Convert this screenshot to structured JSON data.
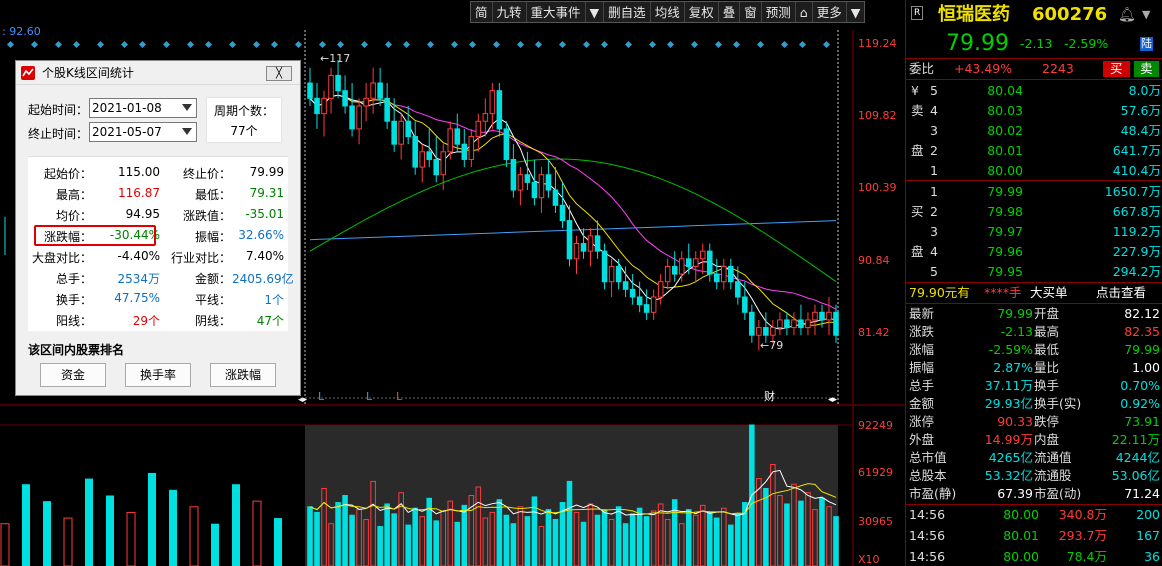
{
  "toolbar": {
    "items": [
      "简",
      "九转",
      "重大事件",
      "▼",
      "删自选",
      "均线",
      "复权",
      "叠",
      "窗",
      "预测",
      "⌂",
      "更多",
      "▼"
    ]
  },
  "chart": {
    "top_left_price": ": 92.60",
    "price_axis": [
      "119.24",
      "109.82",
      "100.39",
      "90.84",
      "81.42"
    ],
    "vol_axis": [
      "92249",
      "61929",
      "30965"
    ],
    "vol_unit": "X10",
    "high_marker": "117",
    "low_marker": "79",
    "bottom_markers": [
      "L",
      "L",
      "L",
      "财"
    ],
    "candles": [
      [
        114,
        116,
        111,
        112
      ],
      [
        112,
        114,
        108,
        110
      ],
      [
        110,
        113,
        107,
        112
      ],
      [
        112,
        116,
        110,
        115
      ],
      [
        115,
        117,
        112,
        113
      ],
      [
        113,
        115,
        110,
        111
      ],
      [
        111,
        114,
        107,
        108
      ],
      [
        108,
        112,
        106,
        111
      ],
      [
        111,
        114,
        109,
        112
      ],
      [
        112,
        116,
        110,
        114
      ],
      [
        114,
        116,
        111,
        112
      ],
      [
        112,
        114,
        108,
        109
      ],
      [
        109,
        112,
        105,
        106
      ],
      [
        106,
        110,
        104,
        109
      ],
      [
        109,
        111,
        106,
        107
      ],
      [
        107,
        109,
        102,
        103
      ],
      [
        103,
        106,
        101,
        105
      ],
      [
        105,
        108,
        103,
        104
      ],
      [
        104,
        107,
        101,
        102
      ],
      [
        102,
        106,
        100,
        105
      ],
      [
        105,
        109,
        104,
        108
      ],
      [
        108,
        110,
        105,
        106
      ],
      [
        106,
        108,
        103,
        104
      ],
      [
        104,
        108,
        103,
        107
      ],
      [
        107,
        110,
        105,
        109
      ],
      [
        109,
        112,
        107,
        110
      ],
      [
        110,
        114,
        108,
        113
      ],
      [
        113,
        114,
        107,
        108
      ],
      [
        108,
        109,
        103,
        104
      ],
      [
        104,
        106,
        99,
        100
      ],
      [
        100,
        103,
        98,
        102
      ],
      [
        102,
        105,
        100,
        101
      ],
      [
        101,
        104,
        98,
        99
      ],
      [
        99,
        103,
        97,
        102
      ],
      [
        102,
        104,
        99,
        100
      ],
      [
        100,
        103,
        97,
        98
      ],
      [
        98,
        101,
        95,
        96
      ],
      [
        96,
        98,
        90,
        91
      ],
      [
        91,
        94,
        89,
        93
      ],
      [
        93,
        95,
        91,
        92
      ],
      [
        92,
        95,
        90,
        94
      ],
      [
        94,
        96,
        91,
        92
      ],
      [
        92,
        93,
        87,
        88
      ],
      [
        88,
        91,
        86,
        90
      ],
      [
        90,
        91,
        87,
        88
      ],
      [
        88,
        90,
        86,
        87
      ],
      [
        87,
        89,
        85,
        86
      ],
      [
        86,
        88,
        84,
        85
      ],
      [
        85,
        87,
        83,
        84
      ],
      [
        84,
        87,
        83,
        86
      ],
      [
        86,
        89,
        85,
        88
      ],
      [
        88,
        91,
        87,
        90
      ],
      [
        90,
        92,
        88,
        89
      ],
      [
        89,
        92,
        88,
        91
      ],
      [
        91,
        93,
        89,
        90
      ],
      [
        90,
        92,
        88,
        91
      ],
      [
        91,
        93,
        89,
        92
      ],
      [
        92,
        93,
        88,
        89
      ],
      [
        89,
        91,
        87,
        88
      ],
      [
        88,
        91,
        87,
        90
      ],
      [
        90,
        91,
        87,
        88
      ],
      [
        88,
        90,
        85,
        86
      ],
      [
        86,
        88,
        83,
        84
      ],
      [
        84,
        85,
        80,
        81
      ],
      [
        81,
        83,
        79,
        82
      ],
      [
        82,
        84,
        80,
        81
      ],
      [
        81,
        83,
        80,
        82
      ],
      [
        82,
        84,
        81,
        83
      ],
      [
        83,
        84,
        81,
        82
      ],
      [
        82,
        84,
        81,
        83
      ],
      [
        83,
        85,
        81,
        82
      ],
      [
        82,
        84,
        81,
        83
      ],
      [
        83,
        85,
        81,
        84
      ],
      [
        84,
        85,
        82,
        83
      ],
      [
        83,
        86,
        81,
        84
      ],
      [
        84,
        85,
        80,
        81
      ]
    ],
    "volumes": [
      0.42,
      0.38,
      0.55,
      0.3,
      0.45,
      0.5,
      0.36,
      0.4,
      0.33,
      0.6,
      0.28,
      0.44,
      0.37,
      0.52,
      0.29,
      0.41,
      0.35,
      0.48,
      0.32,
      0.39,
      0.46,
      0.31,
      0.43,
      0.5,
      0.56,
      0.34,
      0.38,
      0.47,
      0.36,
      0.3,
      0.42,
      0.35,
      0.49,
      0.28,
      0.4,
      0.33,
      0.45,
      0.6,
      0.38,
      0.31,
      0.44,
      0.36,
      0.4,
      0.33,
      0.42,
      0.3,
      0.37,
      0.41,
      0.35,
      0.39,
      0.44,
      0.33,
      0.47,
      0.3,
      0.4,
      0.36,
      0.43,
      0.38,
      0.34,
      0.41,
      0.29,
      0.37,
      0.45,
      1.0,
      0.62,
      0.55,
      0.72,
      0.5,
      0.44,
      0.58,
      0.46,
      0.52,
      0.4,
      0.48,
      0.42,
      0.35
    ]
  },
  "dialog": {
    "title": "个股K线区间统计",
    "close_label": "╳",
    "start_label": "起始时间：",
    "start_value": "2021-01-08",
    "end_label": "终止时间：",
    "end_value": "2021-05-07",
    "period_label": "周期个数：",
    "period_value": "77个",
    "rows": [
      {
        "l1": "起始价：",
        "v1": "115.00",
        "c1": "#000",
        "l2": "终止价：",
        "v2": "79.99",
        "c2": "#000"
      },
      {
        "l1": "最高：",
        "v1": "116.87",
        "c1": "#e00000",
        "l2": "最低：",
        "v2": "79.31",
        "c2": "#008000"
      },
      {
        "l1": "均价：",
        "v1": "94.95",
        "c1": "#000",
        "l2": "涨跌值：",
        "v2": "-35.01",
        "c2": "#008000"
      },
      {
        "l1": "涨跌幅：",
        "v1": "-30.44%",
        "c1": "#008000",
        "l2": "振幅：",
        "v2": "32.66%",
        "c2": "#1070c0"
      },
      {
        "l1": "大盘对比：",
        "v1": "-4.40%",
        "c1": "#000",
        "l2": "行业对比：",
        "v2": "7.40%",
        "c2": "#000"
      },
      {
        "l1": "总手：",
        "v1": "2534万",
        "c1": "#1070c0",
        "l2": "金额：",
        "v2": "2405.69亿",
        "c2": "#1070c0"
      },
      {
        "l1": "换手：",
        "v1": "47.75%",
        "c1": "#1070c0",
        "l2": "平线：",
        "v2": "1个",
        "c2": "#1070c0"
      },
      {
        "l1": "阳线：",
        "v1": "29个",
        "c1": "#e00000",
        "l2": "阴线：",
        "v2": "47个",
        "c2": "#008000"
      }
    ],
    "rank_label": "该区间内股票排名",
    "buttons": [
      "资金",
      "换手率",
      "涨跌幅"
    ]
  },
  "quote": {
    "name": "恒瑞医药",
    "code": "600276",
    "price": "79.99",
    "change": "-2.13",
    "pct": "-2.59%",
    "tag": "陆",
    "weibi_label": "委比",
    "weibi_pct": "+43.49%",
    "weibi_num": "2243",
    "buy_btn": "买",
    "sell_btn": "卖",
    "sell_levels": [
      [
        "¥",
        "5",
        "80.04",
        "8.0万"
      ],
      [
        "卖",
        "4",
        "80.03",
        "57.6万"
      ],
      [
        "",
        "3",
        "80.02",
        "48.4万"
      ],
      [
        "盘",
        "2",
        "80.01",
        "641.7万"
      ],
      [
        "",
        "1",
        "80.00",
        "410.4万"
      ]
    ],
    "buy_levels": [
      [
        "",
        "1",
        "79.99",
        "1650.7万"
      ],
      [
        "买",
        "2",
        "79.98",
        "667.8万"
      ],
      [
        "",
        "3",
        "79.97",
        "119.2万"
      ],
      [
        "盘",
        "4",
        "79.96",
        "227.9万"
      ],
      [
        "",
        "5",
        "79.95",
        "294.2万"
      ]
    ],
    "big_order": {
      "left": "79.90元有",
      "mid": "****手",
      "mid2": "大买单",
      "right": "点击查看"
    },
    "stats": [
      [
        "最新",
        "79.99",
        "grn",
        "开盘",
        "82.12",
        "wht"
      ],
      [
        "涨跌",
        "-2.13",
        "grn",
        "最高",
        "82.35",
        "red"
      ],
      [
        "涨幅",
        "-2.59%",
        "grn",
        "最低",
        "79.99",
        "grn"
      ],
      [
        "振幅",
        "2.87%",
        "cyn",
        "量比",
        "1.00",
        "wht"
      ],
      [
        "总手",
        "37.11万",
        "cyn",
        "换手",
        "0.70%",
        "cyn"
      ],
      [
        "金额",
        "29.93亿",
        "cyn",
        "换手(实)",
        "0.92%",
        "cyn"
      ],
      [
        "涨停",
        "90.33",
        "red",
        "跌停",
        "73.91",
        "grn"
      ],
      [
        "外盘",
        "14.99万",
        "red",
        "内盘",
        "22.11万",
        "grn"
      ],
      [
        "总市值",
        "4265亿",
        "cyn",
        "流通值",
        "4244亿",
        "cyn"
      ],
      [
        "总股本",
        "53.32亿",
        "cyn",
        "流通股",
        "53.06亿",
        "cyn"
      ],
      [
        "市盈(静)",
        "67.39",
        "wht",
        "市盈(动)",
        "71.24",
        "wht"
      ]
    ],
    "ticks": [
      [
        "14:56",
        "80.00",
        "340.8万",
        "200",
        "red"
      ],
      [
        "14:56",
        "80.01",
        "293.7万",
        "167",
        "red"
      ],
      [
        "14:56",
        "80.00",
        "78.4万",
        "36",
        "grn"
      ]
    ]
  },
  "colors": {
    "up": "#ff3b3b",
    "down": "#00e0e0",
    "ma5": "#ffffff",
    "ma10": "#f0e000",
    "ma20": "#ff40ff",
    "ma60": "#00c000",
    "ma120": "#40a0ff"
  }
}
